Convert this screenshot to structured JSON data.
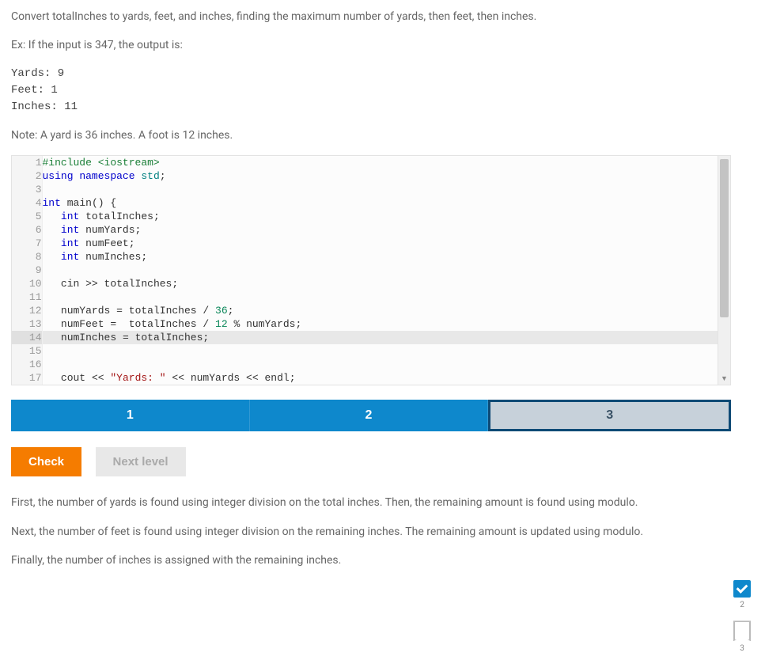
{
  "problem": {
    "desc_line1": "Convert totalInches to yards, feet, and inches, finding the maximum number of yards, then feet, then inches.",
    "example_intro": "Ex: If the input is 347, the output is:",
    "example_output": "Yards: 9\nFeet: 1\nInches: 11",
    "note": "Note: A yard is 36 inches. A foot is 12 inches."
  },
  "code_lines": [
    {
      "n": 1,
      "tokens": [
        [
          "preproc",
          "#include <iostream>"
        ]
      ]
    },
    {
      "n": 2,
      "tokens": [
        [
          "keyword",
          "using"
        ],
        [
          "",
          " "
        ],
        [
          "keyword",
          "namespace"
        ],
        [
          "",
          " "
        ],
        [
          "ns",
          "std"
        ],
        [
          "op",
          ";"
        ]
      ]
    },
    {
      "n": 3,
      "tokens": []
    },
    {
      "n": 4,
      "tokens": [
        [
          "type",
          "int"
        ],
        [
          "",
          " "
        ],
        [
          "ident",
          "main"
        ],
        [
          "op",
          "() {"
        ]
      ]
    },
    {
      "n": 5,
      "tokens": [
        [
          "",
          "   "
        ],
        [
          "type",
          "int"
        ],
        [
          "",
          " "
        ],
        [
          "ident",
          "totalInches"
        ],
        [
          "op",
          ";"
        ]
      ]
    },
    {
      "n": 6,
      "tokens": [
        [
          "",
          "   "
        ],
        [
          "type",
          "int"
        ],
        [
          "",
          " "
        ],
        [
          "ident",
          "numYards"
        ],
        [
          "op",
          ";"
        ]
      ]
    },
    {
      "n": 7,
      "tokens": [
        [
          "",
          "   "
        ],
        [
          "type",
          "int"
        ],
        [
          "",
          " "
        ],
        [
          "ident",
          "numFeet"
        ],
        [
          "op",
          ";"
        ]
      ]
    },
    {
      "n": 8,
      "tokens": [
        [
          "",
          "   "
        ],
        [
          "type",
          "int"
        ],
        [
          "",
          " "
        ],
        [
          "ident",
          "numInches"
        ],
        [
          "op",
          ";"
        ]
      ]
    },
    {
      "n": 9,
      "tokens": []
    },
    {
      "n": 10,
      "tokens": [
        [
          "",
          "   "
        ],
        [
          "ident",
          "cin"
        ],
        [
          "",
          " "
        ],
        [
          "op",
          ">>"
        ],
        [
          "",
          " "
        ],
        [
          "ident",
          "totalInches"
        ],
        [
          "op",
          ";"
        ]
      ]
    },
    {
      "n": 11,
      "tokens": []
    },
    {
      "n": 12,
      "tokens": [
        [
          "",
          "   "
        ],
        [
          "ident",
          "numYards"
        ],
        [
          "",
          " "
        ],
        [
          "op",
          "="
        ],
        [
          "",
          " "
        ],
        [
          "ident",
          "totalInches"
        ],
        [
          "",
          " "
        ],
        [
          "op",
          "/"
        ],
        [
          "",
          " "
        ],
        [
          "num",
          "36"
        ],
        [
          "op",
          ";"
        ]
      ]
    },
    {
      "n": 13,
      "tokens": [
        [
          "",
          "   "
        ],
        [
          "ident",
          "numFeet"
        ],
        [
          "",
          " "
        ],
        [
          "op",
          "="
        ],
        [
          "",
          "  "
        ],
        [
          "ident",
          "totalInches"
        ],
        [
          "",
          " "
        ],
        [
          "op",
          "/"
        ],
        [
          "",
          " "
        ],
        [
          "num",
          "12"
        ],
        [
          "",
          " "
        ],
        [
          "op",
          "%"
        ],
        [
          "",
          " "
        ],
        [
          "ident",
          "numYards"
        ],
        [
          "op",
          ";"
        ]
      ]
    },
    {
      "n": 14,
      "highlight": true,
      "tokens": [
        [
          "",
          "   "
        ],
        [
          "ident",
          "numInches"
        ],
        [
          "",
          " "
        ],
        [
          "op",
          "="
        ],
        [
          "",
          " "
        ],
        [
          "ident",
          "totalInches"
        ],
        [
          "op",
          ";"
        ]
      ]
    },
    {
      "n": 15,
      "tokens": []
    },
    {
      "n": 16,
      "tokens": []
    },
    {
      "n": 17,
      "tokens": [
        [
          "",
          "   "
        ],
        [
          "ident",
          "cout"
        ],
        [
          "",
          " "
        ],
        [
          "op",
          "<<"
        ],
        [
          "",
          " "
        ],
        [
          "string",
          "\"Yards: \""
        ],
        [
          "",
          " "
        ],
        [
          "op",
          "<<"
        ],
        [
          "",
          " "
        ],
        [
          "ident",
          "numYards"
        ],
        [
          "",
          " "
        ],
        [
          "op",
          "<<"
        ],
        [
          "",
          " "
        ],
        [
          "ident",
          "endl"
        ],
        [
          "op",
          ";"
        ]
      ]
    }
  ],
  "tabs": {
    "items": [
      {
        "label": "1",
        "active": true
      },
      {
        "label": "2",
        "active": true
      },
      {
        "label": "3",
        "active": false
      }
    ]
  },
  "actions": {
    "check_label": "Check",
    "next_label": "Next level"
  },
  "explanation": {
    "p1": "First, the number of yards is found using integer division on the total inches. Then, the remaining amount is found using modulo.",
    "p2": "Next, the number of feet is found using integer division on the remaining inches. The remaining amount is updated using modulo.",
    "p3": "Finally, the number of inches is assigned with the remaining inches."
  },
  "sidebar": {
    "item2_label": "2",
    "item3_label": "3"
  }
}
